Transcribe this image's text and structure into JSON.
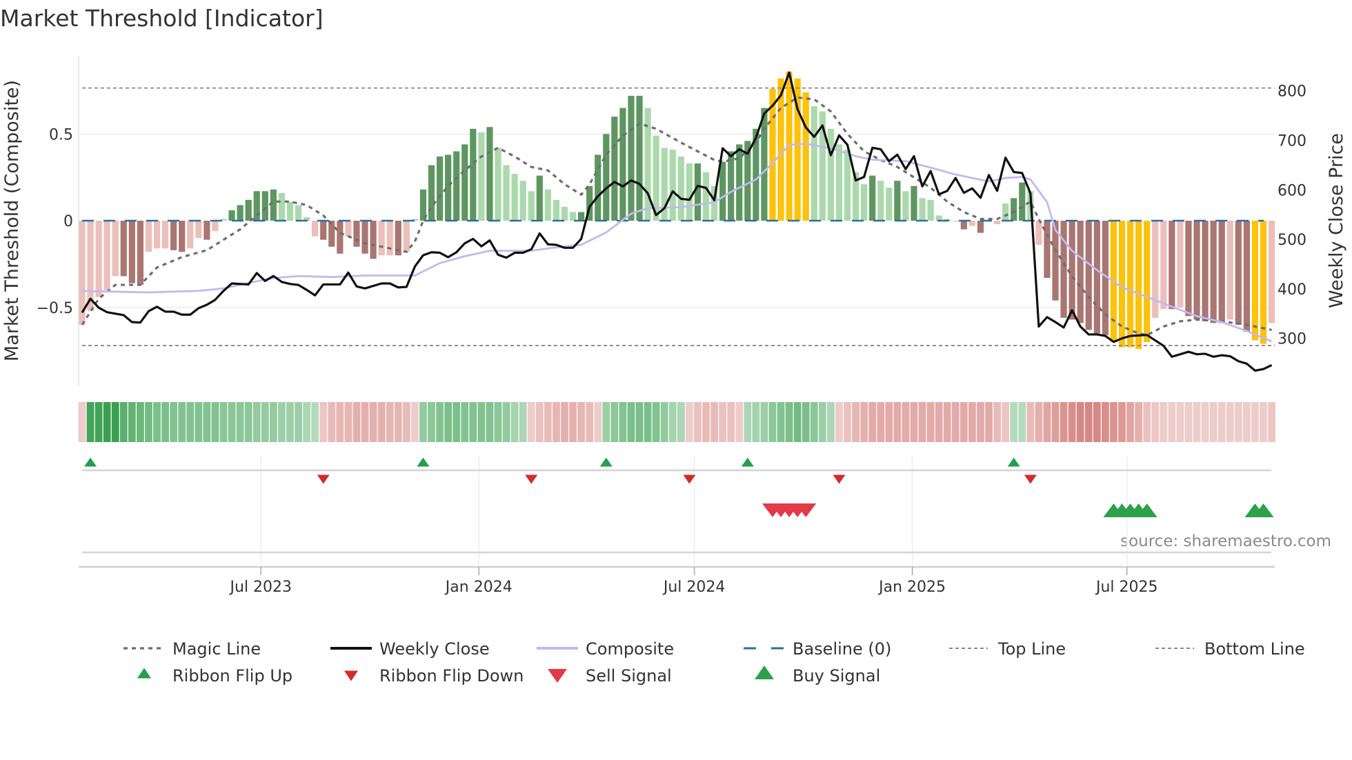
{
  "chart_data": {
    "type": "bar",
    "title": "Market Threshold [Indicator]",
    "ylabel_left": "Market Threshold (Composite)",
    "ylabel_right": "Weekly Close Price",
    "source": "source: sharemaestro.com",
    "ylim_left": [
      -0.95,
      0.95
    ],
    "ylim_right": [
      203,
      871
    ],
    "left_yticks": [
      {
        "label": "0.5",
        "value": 0.5
      },
      {
        "label": "0",
        "value": 0
      },
      {
        "label": "−0.5",
        "value": -0.5
      }
    ],
    "right_yticks": [
      {
        "label": "800",
        "value": 800
      },
      {
        "label": "700",
        "value": 700
      },
      {
        "label": "600",
        "value": 600
      },
      {
        "label": "500",
        "value": 500
      },
      {
        "label": "400",
        "value": 400
      },
      {
        "label": "300",
        "value": 300
      }
    ],
    "x_unit": "week index",
    "x_ticks": [
      {
        "label": "Jul 2023",
        "week": 21.5
      },
      {
        "label": "Jan 2024",
        "week": 47.7
      },
      {
        "label": "Jul 2024",
        "week": 73.6
      },
      {
        "label": "Jan 2025",
        "week": 99.8
      },
      {
        "label": "Jul 2025",
        "week": 125.6
      }
    ],
    "palette": {
      "light_red": "#ebbfba",
      "dark_red": "#a97672",
      "light_green": "#acd9ac",
      "dark_green": "#5e9661",
      "yellow": "#fcc20c",
      "baseline": "#2a6f9e",
      "composite": "#c2b9ef",
      "close": "#111111",
      "magic": "#6e6e72",
      "flip_up": "#22a04a",
      "flip_down": "#d42a2a",
      "sell": "#e23a48",
      "buy": "#2ea04c"
    },
    "bar_category_legend": [
      "light_red",
      "dark_red",
      "light_green",
      "dark_green",
      "yellow"
    ],
    "histogram": [
      -0.6,
      -0.52,
      -0.44,
      -0.4,
      -0.32,
      -0.32,
      -0.36,
      -0.37,
      -0.18,
      -0.16,
      -0.16,
      -0.17,
      -0.18,
      -0.16,
      -0.1,
      -0.11,
      -0.06,
      0.01,
      0.06,
      0.09,
      0.12,
      0.17,
      0.17,
      0.18,
      0.16,
      0.11,
      0.09,
      0.02,
      -0.09,
      -0.11,
      -0.15,
      -0.19,
      -0.09,
      -0.15,
      -0.19,
      -0.22,
      -0.2,
      -0.2,
      -0.2,
      -0.18,
      0.01,
      0.18,
      0.32,
      0.37,
      0.38,
      0.4,
      0.44,
      0.53,
      0.51,
      0.54,
      0.42,
      0.32,
      0.27,
      0.23,
      0.17,
      0.26,
      0.18,
      0.12,
      0.08,
      0.05,
      0.05,
      0.2,
      0.38,
      0.5,
      0.6,
      0.65,
      0.72,
      0.72,
      0.65,
      0.49,
      0.42,
      0.41,
      0.37,
      0.33,
      0.33,
      0.28,
      0.2,
      0.34,
      0.4,
      0.44,
      0.46,
      0.53,
      0.65,
      0.76,
      0.82,
      0.86,
      0.82,
      0.74,
      0.66,
      0.63,
      0.53,
      0.44,
      0.41,
      0.28,
      0.21,
      0.26,
      0.23,
      0.19,
      0.23,
      0.17,
      0.2,
      0.13,
      0.12,
      0.03,
      0.01,
      -0.005,
      -0.05,
      -0.03,
      -0.07,
      -0.005,
      -0.02,
      0.1,
      0.13,
      0.22,
      0.17,
      -0.14,
      -0.33,
      -0.46,
      -0.56,
      -0.57,
      -0.59,
      -0.63,
      -0.65,
      -0.66,
      -0.7,
      -0.73,
      -0.73,
      -0.74,
      -0.7,
      -0.56,
      -0.51,
      -0.51,
      -0.5,
      -0.55,
      -0.57,
      -0.58,
      -0.59,
      -0.59,
      -0.57,
      -0.6,
      -0.64,
      -0.69,
      -0.71,
      -0.59
    ],
    "bar_category": [
      0,
      0,
      0,
      0,
      0,
      1,
      1,
      1,
      0,
      0,
      0,
      1,
      1,
      0,
      0,
      1,
      0,
      2,
      3,
      3,
      3,
      3,
      3,
      3,
      2,
      2,
      2,
      2,
      0,
      1,
      1,
      1,
      0,
      1,
      1,
      1,
      0,
      0,
      1,
      0,
      2,
      3,
      3,
      3,
      3,
      3,
      3,
      3,
      2,
      3,
      2,
      2,
      2,
      2,
      2,
      3,
      2,
      2,
      2,
      2,
      3,
      3,
      3,
      3,
      3,
      3,
      3,
      3,
      2,
      2,
      2,
      2,
      2,
      2,
      3,
      2,
      2,
      3,
      3,
      3,
      3,
      3,
      3,
      4,
      4,
      4,
      4,
      4,
      2,
      2,
      2,
      2,
      2,
      2,
      2,
      3,
      2,
      2,
      3,
      2,
      3,
      2,
      2,
      2,
      2,
      0,
      1,
      0,
      1,
      0,
      0,
      2,
      3,
      3,
      2,
      0,
      1,
      1,
      1,
      1,
      1,
      1,
      1,
      1,
      4,
      4,
      4,
      4,
      4,
      0,
      0,
      1,
      0,
      1,
      1,
      1,
      1,
      1,
      0,
      1,
      1,
      4,
      4,
      0
    ],
    "weekly_close": [
      352,
      380,
      362,
      353,
      350,
      347,
      333,
      332,
      355,
      364,
      354,
      354,
      348,
      348,
      361,
      368,
      378,
      396,
      411,
      410,
      409,
      432,
      416,
      426,
      414,
      410,
      408,
      398,
      387,
      409,
      409,
      409,
      433,
      405,
      401,
      406,
      411,
      411,
      403,
      404,
      445,
      468,
      474,
      473,
      464,
      474,
      492,
      501,
      486,
      498,
      469,
      463,
      473,
      473,
      480,
      512,
      490,
      489,
      483,
      483,
      501,
      566,
      587,
      603,
      616,
      607,
      619,
      612,
      593,
      549,
      563,
      597,
      582,
      580,
      608,
      604,
      579,
      684,
      668,
      682,
      673,
      705,
      754,
      770,
      791,
      837,
      763,
      726,
      707,
      730,
      670,
      710,
      691,
      619,
      626,
      685,
      682,
      658,
      671,
      642,
      668,
      607,
      638,
      591,
      598,
      624,
      594,
      603,
      584,
      630,
      598,
      665,
      636,
      634,
      593,
      324,
      343,
      333,
      322,
      357,
      324,
      308,
      308,
      305,
      293,
      300,
      305,
      306,
      307,
      296,
      285,
      263,
      268,
      273,
      268,
      269,
      263,
      266,
      264,
      254,
      249,
      235,
      238,
      246
    ],
    "composite": [
      [
        0,
        396
      ],
      [
        5,
        394
      ],
      [
        8,
        393
      ],
      [
        14,
        396
      ],
      [
        17,
        401
      ],
      [
        20,
        412
      ],
      [
        23,
        422
      ],
      [
        26,
        426
      ],
      [
        30,
        424
      ],
      [
        34,
        427
      ],
      [
        40,
        427
      ],
      [
        43,
        452
      ],
      [
        46,
        466
      ],
      [
        49,
        477
      ],
      [
        54,
        477
      ],
      [
        57,
        484
      ],
      [
        60,
        489
      ],
      [
        63,
        514
      ],
      [
        66,
        552
      ],
      [
        68,
        563
      ],
      [
        72,
        565
      ],
      [
        76,
        575
      ],
      [
        78,
        596
      ],
      [
        81,
        621
      ],
      [
        83,
        654
      ],
      [
        85,
        691
      ],
      [
        87,
        693
      ],
      [
        90,
        684
      ],
      [
        93,
        668
      ],
      [
        95,
        661
      ],
      [
        99,
        658
      ],
      [
        102,
        645
      ],
      [
        105,
        631
      ],
      [
        109,
        617
      ],
      [
        111,
        624
      ],
      [
        113,
        626
      ],
      [
        114,
        621
      ],
      [
        116,
        575
      ],
      [
        117,
        519
      ],
      [
        119,
        477
      ],
      [
        122,
        438
      ],
      [
        125,
        403
      ],
      [
        128,
        384
      ],
      [
        131,
        364
      ],
      [
        134,
        345
      ],
      [
        137,
        333
      ],
      [
        140,
        315
      ],
      [
        143,
        294
      ]
    ],
    "magic_line": [
      [
        0,
        -0.6
      ],
      [
        2,
        -0.45
      ],
      [
        4,
        -0.37
      ],
      [
        7,
        -0.37
      ],
      [
        9,
        -0.27
      ],
      [
        12,
        -0.21
      ],
      [
        15,
        -0.17
      ],
      [
        17,
        -0.11
      ],
      [
        19,
        -0.05
      ],
      [
        21,
        0.03
      ],
      [
        23,
        0.11
      ],
      [
        25,
        0.11
      ],
      [
        27,
        0.09
      ],
      [
        29,
        0.03
      ],
      [
        31,
        -0.07
      ],
      [
        34,
        -0.13
      ],
      [
        38,
        -0.17
      ],
      [
        39,
        -0.18
      ],
      [
        40,
        -0.12
      ],
      [
        41,
        0.0
      ],
      [
        42,
        0.08
      ],
      [
        44,
        0.2
      ],
      [
        46,
        0.29
      ],
      [
        48,
        0.37
      ],
      [
        50,
        0.42
      ],
      [
        52,
        0.37
      ],
      [
        54,
        0.31
      ],
      [
        56,
        0.29
      ],
      [
        58,
        0.21
      ],
      [
        60,
        0.15
      ],
      [
        61,
        0.21
      ],
      [
        63,
        0.38
      ],
      [
        65,
        0.49
      ],
      [
        67,
        0.56
      ],
      [
        69,
        0.53
      ],
      [
        72,
        0.45
      ],
      [
        74,
        0.4
      ],
      [
        76,
        0.35
      ],
      [
        77,
        0.34
      ],
      [
        79,
        0.36
      ],
      [
        81,
        0.45
      ],
      [
        82,
        0.53
      ],
      [
        84,
        0.65
      ],
      [
        86,
        0.71
      ],
      [
        88,
        0.7
      ],
      [
        90,
        0.63
      ],
      [
        92,
        0.5
      ],
      [
        94,
        0.4
      ],
      [
        96,
        0.35
      ],
      [
        98,
        0.31
      ],
      [
        100,
        0.25
      ],
      [
        102,
        0.19
      ],
      [
        104,
        0.11
      ],
      [
        106,
        0.05
      ],
      [
        108,
        0.01
      ],
      [
        110,
        0.01
      ],
      [
        112,
        0.05
      ],
      [
        114,
        0.11
      ],
      [
        115,
        0.01
      ],
      [
        117,
        -0.17
      ],
      [
        119,
        -0.32
      ],
      [
        121,
        -0.44
      ],
      [
        123,
        -0.54
      ],
      [
        125,
        -0.61
      ],
      [
        127,
        -0.65
      ],
      [
        128,
        -0.66
      ],
      [
        130,
        -0.61
      ],
      [
        132,
        -0.58
      ],
      [
        134,
        -0.57
      ],
      [
        137,
        -0.58
      ],
      [
        140,
        -0.6
      ],
      [
        143,
        -0.63
      ]
    ],
    "top_line": 0.765,
    "bottom_line": -0.72,
    "baseline": 0,
    "ribbon": [
      -0.2,
      0.9,
      0.9,
      0.95,
      0.95,
      0.75,
      0.7,
      0.65,
      0.6,
      0.55,
      0.55,
      0.5,
      0.5,
      0.5,
      0.5,
      0.5,
      0.5,
      0.45,
      0.45,
      0.45,
      0.45,
      0.4,
      0.4,
      0.4,
      0.35,
      0.35,
      0.35,
      0.25,
      0.2,
      -0.25,
      -0.35,
      -0.4,
      -0.4,
      -0.45,
      -0.45,
      -0.45,
      -0.45,
      -0.4,
      -0.4,
      -0.35,
      -0.2,
      0.4,
      0.45,
      0.5,
      0.55,
      0.55,
      0.5,
      0.5,
      0.5,
      0.5,
      0.45,
      0.4,
      0.3,
      0.25,
      -0.2,
      -0.3,
      -0.35,
      -0.4,
      -0.45,
      -0.45,
      -0.4,
      -0.35,
      -0.2,
      0.35,
      0.45,
      0.5,
      0.55,
      0.55,
      0.55,
      0.5,
      0.4,
      0.3,
      0.25,
      -0.2,
      -0.3,
      -0.35,
      -0.35,
      -0.3,
      -0.3,
      -0.2,
      0.25,
      0.3,
      0.35,
      0.45,
      0.5,
      0.55,
      0.6,
      0.55,
      0.45,
      0.35,
      0.25,
      -0.2,
      -0.3,
      -0.4,
      -0.45,
      -0.5,
      -0.5,
      -0.5,
      -0.5,
      -0.5,
      -0.5,
      -0.5,
      -0.5,
      -0.5,
      -0.5,
      -0.5,
      -0.5,
      -0.5,
      -0.5,
      -0.5,
      -0.35,
      -0.25,
      0.2,
      0.2,
      -0.35,
      -0.45,
      -0.55,
      -0.6,
      -0.7,
      -0.75,
      -0.8,
      -0.8,
      -0.8,
      -0.75,
      -0.7,
      -0.65,
      -0.55,
      -0.45,
      -0.3,
      -0.25,
      -0.2,
      -0.2,
      -0.2,
      -0.2,
      -0.2,
      -0.2,
      -0.2,
      -0.2,
      -0.2,
      -0.2,
      -0.2,
      -0.2,
      -0.2,
      -0.25
    ],
    "ribbon_flip_up": [
      1,
      41,
      63,
      80,
      112
    ],
    "ribbon_flip_down": [
      29,
      54,
      73,
      91,
      114
    ],
    "sell_signal": [
      83,
      84,
      85,
      86,
      87
    ],
    "buy_signal": [
      124,
      125,
      126,
      127,
      128,
      141,
      142
    ],
    "legend": [
      {
        "label": "Magic Line",
        "kind": "magic"
      },
      {
        "label": "Weekly Close",
        "kind": "close"
      },
      {
        "label": "Composite",
        "kind": "composite"
      },
      {
        "label": "Baseline (0)",
        "kind": "baseline"
      },
      {
        "label": "Top Line",
        "kind": "thresh"
      },
      {
        "label": "Bottom Line",
        "kind": "thresh"
      },
      {
        "label": "Ribbon Flip Up",
        "kind": "flip_up"
      },
      {
        "label": "Ribbon Flip Down",
        "kind": "flip_down"
      },
      {
        "label": "Sell Signal",
        "kind": "sell"
      },
      {
        "label": "Buy Signal",
        "kind": "buy"
      }
    ]
  }
}
